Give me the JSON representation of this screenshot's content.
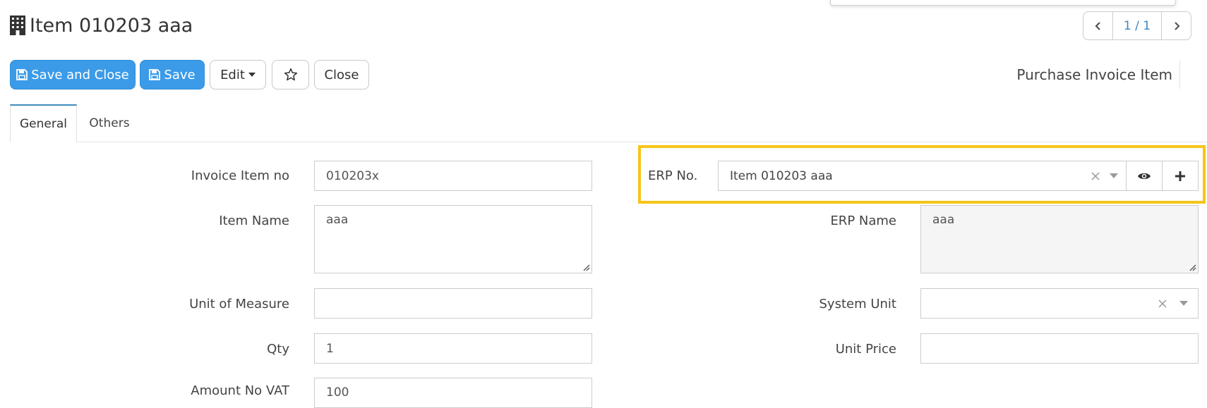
{
  "header": {
    "title": "Item 010203 aaa",
    "title_icon": "building-icon",
    "form_type": "Purchase Invoice Item"
  },
  "pager": {
    "current": "1 / 1"
  },
  "toolbar": {
    "save_and_close": "Save and Close",
    "save": "Save",
    "edit": "Edit",
    "close": "Close"
  },
  "tabs": [
    {
      "label": "General",
      "active": true
    },
    {
      "label": "Others",
      "active": false
    }
  ],
  "form": {
    "invoice_item_no": {
      "label": "Invoice Item no",
      "value": "010203x"
    },
    "item_name": {
      "label": "Item Name",
      "value": "aaa"
    },
    "unit_of_measure": {
      "label": "Unit of Measure",
      "value": ""
    },
    "qty": {
      "label": "Qty",
      "value": "1"
    },
    "amount_no_vat": {
      "label": "Amount No VAT",
      "value": "100"
    },
    "erp_no": {
      "label": "ERP No.",
      "value": "Item 010203 aaa"
    },
    "erp_name": {
      "label": "ERP Name",
      "value": "aaa"
    },
    "system_unit": {
      "label": "System Unit",
      "value": ""
    },
    "unit_price": {
      "label": "Unit Price",
      "value": ""
    }
  },
  "colors": {
    "primary": "#3c9be8",
    "highlight": "#f5c518",
    "tab_accent": "#3c8dbc",
    "pager_text": "#3a87c4"
  }
}
